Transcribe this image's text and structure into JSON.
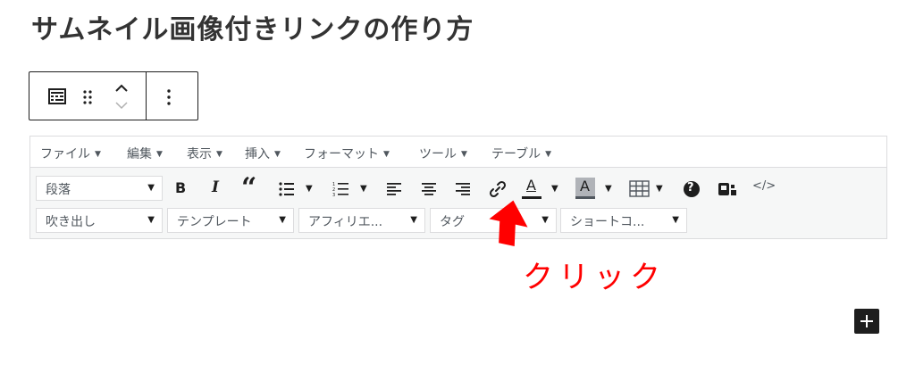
{
  "page_title": "サムネイル画像付きリンクの作り方",
  "block_toolbar": {
    "icons": [
      "classic-block-icon",
      "drag-handle-icon",
      "move-up-icon",
      "move-down-icon",
      "more-options-icon"
    ]
  },
  "menubar": {
    "items": [
      {
        "label": "ファイル"
      },
      {
        "label": "編集"
      },
      {
        "label": "表示"
      },
      {
        "label": "挿入"
      },
      {
        "label": "フォーマット"
      },
      {
        "label": "ツール"
      },
      {
        "label": "テーブル"
      }
    ],
    "caret": "▼"
  },
  "toolbar": {
    "format_select": "段落",
    "bold_label": "B",
    "italic_label": "I",
    "blockquote_label": "“",
    "text_color_label": "A",
    "bg_color_label": "A",
    "help_label": "?",
    "code_label": "</>"
  },
  "selects_row2": [
    {
      "label": "吹き出し"
    },
    {
      "label": "テンプレート"
    },
    {
      "label": "アフィリエ..."
    },
    {
      "label": "タグ"
    },
    {
      "label": "ショートコ..."
    }
  ],
  "annotation": {
    "label": "クリック",
    "color": "#ff0000"
  },
  "colors": {
    "text_color_swatch": "#1e1e1e",
    "bg_color_swatch": "#8c8f94",
    "toolbar_bg": "#f6f7f7"
  }
}
